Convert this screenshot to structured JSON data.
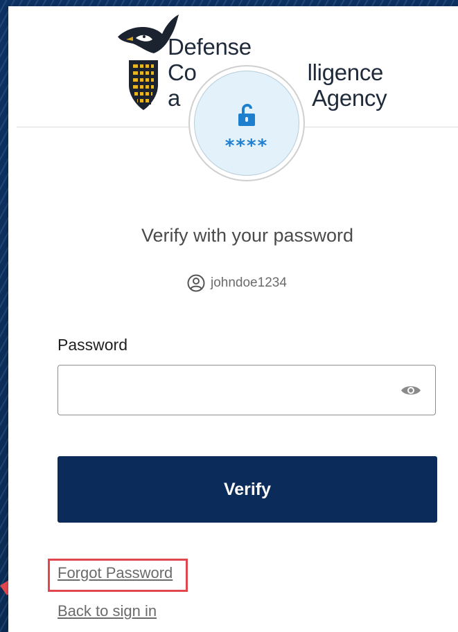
{
  "logo": {
    "lines": [
      "Defense",
      "Counterintelligence",
      "and Security Agency"
    ],
    "visible_lines": [
      "Defense",
      "Co",
      "a"
    ],
    "visible_right": [
      "",
      "lligence",
      "Agency"
    ]
  },
  "auth_icon": {
    "icon": "lock-open-icon",
    "stars": "****"
  },
  "title": "Verify with your password",
  "user": {
    "icon": "user-circle-icon",
    "name": "johndoe1234"
  },
  "password": {
    "label": "Password",
    "value": "",
    "toggle_icon": "eye-icon"
  },
  "verify_button": "Verify",
  "links": {
    "forgot": "Forgot Password",
    "back": "Back to sign in"
  },
  "colors": {
    "primary": "#0b2b5a",
    "highlight": "#e0464e",
    "icon_blue": "#1f7fcf"
  }
}
